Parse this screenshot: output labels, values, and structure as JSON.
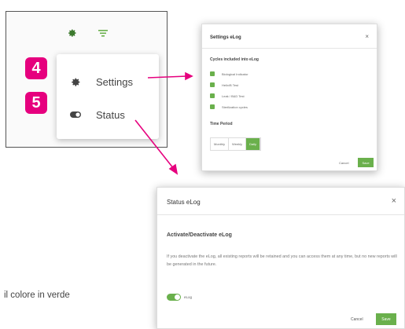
{
  "colors": {
    "accent": "#6ab04c",
    "badge": "#e6007e"
  },
  "menu": {
    "items": [
      {
        "badge": "4",
        "icon": "gear-icon",
        "label": "Settings"
      },
      {
        "badge": "5",
        "icon": "toggle-icon",
        "label": "Status"
      }
    ]
  },
  "settings_dialog": {
    "title": "Settings eLog",
    "close": "×",
    "section_cycles": "Cycles included into eLog",
    "cycles": [
      "Biological Indicator",
      "Helix/B Test",
      "Leak / B&D Test",
      "Sterilization cycles"
    ],
    "section_period": "Time Period",
    "periods": [
      "Monthly",
      "Weekly",
      "Daily"
    ],
    "active_period": "Daily",
    "cancel": "Cancel",
    "save": "Save"
  },
  "status_dialog": {
    "title": "Status eLog",
    "close": "×",
    "heading": "Activate/Deactivate eLog",
    "description": "If you deactivate the eLog, all existing reports will be retained and you can access them at any time, but no new reports will be generated in the future.",
    "toggle_label": "eLog",
    "cancel": "Cancel",
    "save": "Save"
  },
  "caption": "il colore in verde"
}
